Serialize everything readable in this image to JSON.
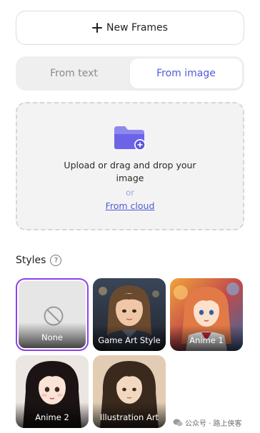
{
  "new_frames": {
    "label": "New Frames"
  },
  "tabs": [
    {
      "label": "From text",
      "active": false
    },
    {
      "label": "From image",
      "active": true
    }
  ],
  "upload": {
    "instruction": "Upload or drag and drop your image",
    "or": "or",
    "cloud_link": "From cloud"
  },
  "styles": {
    "title": "Styles",
    "help": "?",
    "items": [
      {
        "label": "None",
        "selected": true
      },
      {
        "label": "Game Art Style",
        "selected": false
      },
      {
        "label": "Anime 1",
        "selected": false
      },
      {
        "label": "Anime 2",
        "selected": false
      },
      {
        "label": "Illustration Art",
        "selected": false
      }
    ]
  },
  "watermark": {
    "text": "公众号 · 路上侠客"
  },
  "colors": {
    "accent": "#4f5bd5",
    "selected_border": "#8d41e9",
    "folder": "#6d63e8"
  }
}
